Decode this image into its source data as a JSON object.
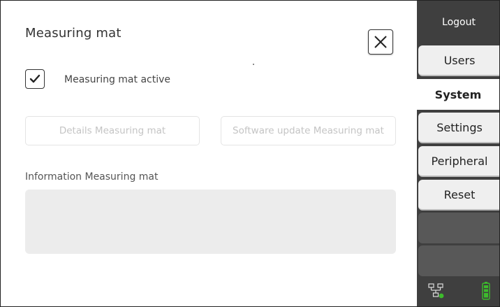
{
  "dialog": {
    "title": "Measuring mat",
    "close_label": "×"
  },
  "checkbox": {
    "checked": true,
    "label": "Measuring mat active"
  },
  "buttons": {
    "details_label": "Details Measuring mat",
    "software_update_label": "Software update Measuring mat",
    "enabled": false
  },
  "information": {
    "label": "Information Measuring mat",
    "content": ""
  },
  "sidebar": {
    "logout_label": "Logout",
    "tabs": [
      {
        "label": "Users",
        "active": false
      },
      {
        "label": "System",
        "active": true
      },
      {
        "label": "Settings",
        "active": false
      },
      {
        "label": "Peripheral",
        "active": false
      },
      {
        "label": "Reset",
        "active": false
      }
    ],
    "empty_slots": 2
  },
  "status": {
    "network_icon": "network-connected-icon",
    "battery_icon": "battery-full-icon"
  },
  "colors": {
    "sidebar_bg": "#3f3f3f",
    "tab_bg": "#efefef",
    "empty_tab_bg": "#585858",
    "info_box_bg": "#ececec",
    "disabled_text": "#c4c4c4",
    "status_green": "#3dbb2c"
  }
}
